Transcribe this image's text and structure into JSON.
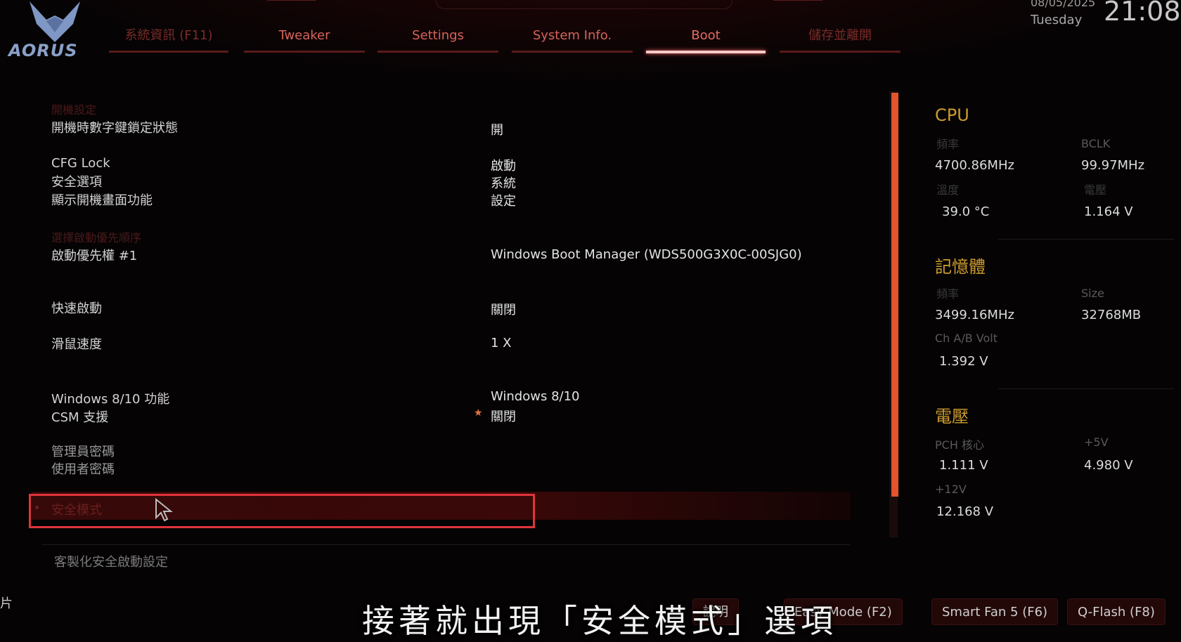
{
  "brand": {
    "logo_text": "AORUS"
  },
  "datetime": {
    "date": "08/05/2025",
    "day": "Tuesday",
    "time": "21:08"
  },
  "nav": {
    "tabs": [
      {
        "label": "系統資訊 (F11)"
      },
      {
        "label": "Tweaker"
      },
      {
        "label": "Settings"
      },
      {
        "label": "System Info."
      },
      {
        "label": "Boot"
      },
      {
        "label": "儲存並離開"
      }
    ],
    "active": "Boot"
  },
  "settings": {
    "section_boot": "開機設定",
    "numlock_label": "開機時數字鍵鎖定狀態",
    "numlock_value": "開",
    "cfg_lock_label": "CFG Lock",
    "cfg_lock_value": "啟動",
    "security_option_label": "安全選項",
    "security_option_value": "系統",
    "full_screen_logo_label": "顯示開機畫面功能",
    "full_screen_logo_value": "設定",
    "section_boot_priority": "選擇啟動優先順序",
    "boot_option1_label": "啟動優先權 #1",
    "boot_option1_value": "Windows Boot Manager (WDS500G3X0C-00SJG0)",
    "fast_boot_label": "快速啟動",
    "fast_boot_value": "關閉",
    "mouse_speed_label": "滑鼠速度",
    "mouse_speed_value": "1 X",
    "windows_feature_label": "Windows 8/10 功能",
    "windows_feature_value": "Windows 8/10",
    "csm_label": "CSM 支援",
    "csm_value": "關閉",
    "admin_password_label": "管理員密碼",
    "user_password_label": "使用者密碼",
    "safe_mode_label": "安全模式",
    "custom_secure_boot_label": "客製化安全啟動設定"
  },
  "hardware": {
    "cpu": {
      "title": "CPU",
      "freq_label": "頻率",
      "freq_value": "4700.86MHz",
      "bclk_label": "BCLK",
      "bclk_value": "99.97MHz",
      "temp_label": "溫度",
      "temp_value": "39.0 °C",
      "voltage_label": "電壓",
      "voltage_value": "1.164 V"
    },
    "memory": {
      "title": "記憶體",
      "freq_label": "頻率",
      "freq_value": "3499.16MHz",
      "size_label": "Size",
      "size_value": "32768MB",
      "volt_label": "Ch A/B Volt",
      "volt_value": "1.392 V"
    },
    "voltage": {
      "title": "電壓",
      "pch_label": "PCH 核心",
      "pch_value": "1.111 V",
      "v5_label": "+5V",
      "v5_value": "4.980 V",
      "v12_label": "+12V",
      "v12_value": "12.168 V"
    }
  },
  "footer": {
    "help_label": "說明",
    "easy_mode_label": "Easy Mode (F2)",
    "smart_fan_label": "Smart Fan 5 (F6)",
    "qflash_label": "Q-Flash (F8)"
  },
  "caption": "接著就出現「安全模式」選項",
  "edge_char": "片",
  "colors": {
    "accent": "#e46c62",
    "selection": "#e0343a",
    "scroll": "#e3542d",
    "hw_title": "#cc9b2e"
  }
}
